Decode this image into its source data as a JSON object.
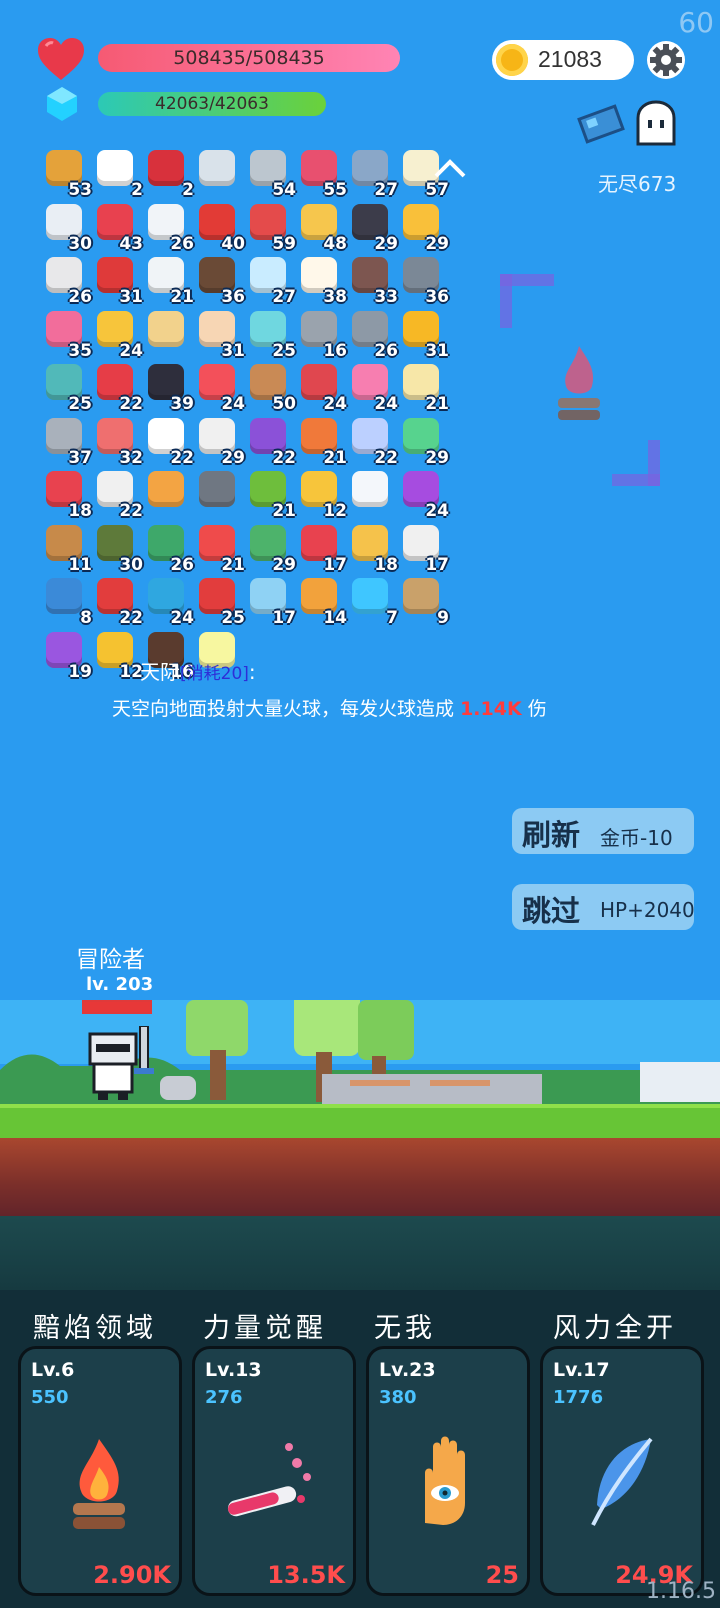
{
  "fps": "60",
  "version": "1.16.5",
  "hp": {
    "text": "508435/508435"
  },
  "mp": {
    "text": "42063/42063"
  },
  "coins": "21083",
  "endless_label": "无尽673",
  "items": [
    {
      "icon": "book-icon",
      "count": "53",
      "color": "#e4a23a"
    },
    {
      "icon": "speech-bubble-icon",
      "count": "2",
      "color": "#ffffff"
    },
    {
      "icon": "magnet-icon",
      "count": "2",
      "color": "#d8313c"
    },
    {
      "icon": "sword-icon",
      "count": "",
      "color": "#d9e2ea"
    },
    {
      "icon": "sword-icon",
      "count": "54",
      "color": "#bcc6cf"
    },
    {
      "icon": "jar-icon",
      "count": "55",
      "color": "#e8506f"
    },
    {
      "icon": "shield-icon",
      "count": "27",
      "color": "#8aa7c8"
    },
    {
      "icon": "flower-icon",
      "count": "57",
      "color": "#f7f0d0"
    },
    {
      "icon": "envelope-icon",
      "count": "30",
      "color": "#e9eef4"
    },
    {
      "icon": "watermelon-icon",
      "count": "43",
      "color": "#e8414f"
    },
    {
      "icon": "cloud-icon",
      "count": "26",
      "color": "#f1f4f8"
    },
    {
      "icon": "apple-icon",
      "count": "40",
      "color": "#e23b36"
    },
    {
      "icon": "sock-icon",
      "count": "59",
      "color": "#e44b4b"
    },
    {
      "icon": "star-card-icon",
      "count": "48",
      "color": "#f6c64d"
    },
    {
      "icon": "cauldron-icon",
      "count": "29",
      "color": "#3c3c4a"
    },
    {
      "icon": "sun-cloud-icon",
      "count": "29",
      "color": "#f9c03a"
    },
    {
      "icon": "dice-icon",
      "count": "26",
      "color": "#e8e8ea"
    },
    {
      "icon": "mushroom-icon",
      "count": "31",
      "color": "#df3a3a"
    },
    {
      "icon": "clipboard-icon",
      "count": "21",
      "color": "#f0f4f7"
    },
    {
      "icon": "coconut-icon",
      "count": "36",
      "color": "#6a4a36"
    },
    {
      "icon": "halo-icon",
      "count": "27",
      "color": "#c9ecff"
    },
    {
      "icon": "egg-icon",
      "count": "38",
      "color": "#fff8ea"
    },
    {
      "icon": "door-icon",
      "count": "33",
      "color": "#7d5650"
    },
    {
      "icon": "axe-icon",
      "count": "36",
      "color": "#7b8896"
    },
    {
      "icon": "ice-cream-icon",
      "count": "35",
      "color": "#f26d9b"
    },
    {
      "icon": "crown-icon",
      "count": "24",
      "color": "#f7c53b"
    },
    {
      "icon": "scroll-icon",
      "count": "",
      "color": "#f2d28c"
    },
    {
      "icon": "hand-icon",
      "count": "31",
      "color": "#f7d6b4"
    },
    {
      "icon": "scroll-icon",
      "count": "25",
      "color": "#6fd7e0"
    },
    {
      "icon": "meteor-icon",
      "count": "16",
      "color": "#9aa3ad"
    },
    {
      "icon": "clock-icon",
      "count": "26",
      "color": "#8d99a6"
    },
    {
      "icon": "sunflower-icon",
      "count": "31",
      "color": "#f7b825"
    },
    {
      "icon": "target-ring-icon",
      "count": "25",
      "color": "#51b9b9"
    },
    {
      "icon": "strawberry-icon",
      "count": "22",
      "color": "#e63d47"
    },
    {
      "icon": "bat-icon",
      "count": "39",
      "color": "#2e2e3c"
    },
    {
      "icon": "pill-icon",
      "count": "24",
      "color": "#f3505a"
    },
    {
      "icon": "donut-icon",
      "count": "50",
      "color": "#c98a55"
    },
    {
      "icon": "badge-icon",
      "count": "24",
      "color": "#e0474f"
    },
    {
      "icon": "potion-icon",
      "count": "24",
      "color": "#f77eb0"
    },
    {
      "icon": "note-icon",
      "count": "21",
      "color": "#f7e7a8"
    },
    {
      "icon": "spike-ball-icon",
      "count": "37",
      "color": "#a9b1bb"
    },
    {
      "icon": "meat-icon",
      "count": "32",
      "color": "#ef6f6f"
    },
    {
      "icon": "ghost-icon",
      "count": "22",
      "color": "#ffffff"
    },
    {
      "icon": "bulb-icon",
      "count": "29",
      "color": "#f0f0f0"
    },
    {
      "icon": "box-icon",
      "count": "22",
      "color": "#8b51d8"
    },
    {
      "icon": "flag-icon",
      "count": "21",
      "color": "#f0793a"
    },
    {
      "icon": "capsule-icon",
      "count": "22",
      "color": "#bcd0ff"
    },
    {
      "icon": "slime-icon",
      "count": "29",
      "color": "#57d38e"
    },
    {
      "icon": "heart-icon",
      "count": "18",
      "color": "#e8424f"
    },
    {
      "icon": "cards-icon",
      "count": "22",
      "color": "#f0f0f0"
    },
    {
      "icon": "map-scroll-icon",
      "count": "",
      "color": "#f3a443"
    },
    {
      "icon": "helmet-icon",
      "count": "",
      "color": "#6f7782"
    },
    {
      "icon": "zombie-icon",
      "count": "21",
      "color": "#6ebe3c"
    },
    {
      "icon": "wand-icon",
      "count": "12",
      "color": "#f7c53b"
    },
    {
      "icon": "wing-icon",
      "count": "",
      "color": "#f4f7fb"
    },
    {
      "icon": "crystal-ball-icon",
      "count": "24",
      "color": "#a64ce0"
    },
    {
      "icon": "bow-icon",
      "count": "11",
      "color": "#c78a4a"
    },
    {
      "icon": "grenade-icon",
      "count": "30",
      "color": "#5e7a3a"
    },
    {
      "icon": "turtle-icon",
      "count": "26",
      "color": "#3ea86a"
    },
    {
      "icon": "thermometer-icon",
      "count": "21",
      "color": "#ef4b4b"
    },
    {
      "icon": "cash-icon",
      "count": "29",
      "color": "#4db36b"
    },
    {
      "icon": "broken-heart-icon",
      "count": "17",
      "color": "#e8424f"
    },
    {
      "icon": "ring-icon",
      "count": "18",
      "color": "#f5c24b"
    },
    {
      "icon": "feather-red-icon",
      "count": "17",
      "color": "#f0f0f0"
    },
    {
      "icon": "crosshair-icon",
      "count": "8",
      "color": "#3b8ad8"
    },
    {
      "icon": "gift-icon",
      "count": "22",
      "color": "#e23d3d"
    },
    {
      "icon": "chat-icon",
      "count": "24",
      "color": "#2fa7e0"
    },
    {
      "icon": "red-card-icon",
      "count": "25",
      "color": "#e23d3d"
    },
    {
      "icon": "snow-globe-icon",
      "count": "17",
      "color": "#8fd2f4"
    },
    {
      "icon": "quest-scroll-icon",
      "count": "14",
      "color": "#f2a23c"
    },
    {
      "icon": "gem-icon",
      "count": "7",
      "color": "#3fc6ff"
    },
    {
      "icon": "noose-icon",
      "count": "9",
      "color": "#c9a16a"
    },
    {
      "icon": "purple-shield-icon",
      "count": "19",
      "color": "#9a56e0"
    },
    {
      "icon": "coins-icon",
      "count": "12",
      "color": "#f5c230"
    },
    {
      "icon": "meteor-card-icon",
      "count": "16",
      "color": "#5a3b2e"
    },
    {
      "icon": "light-card-icon",
      "count": "",
      "color": "#f7f7a0"
    }
  ],
  "skill": {
    "name_fragment": "天际",
    "cost": "[消耗20]",
    "colon": ":",
    "desc_prefix": "天空向地面投射大量火球，每发火球造成",
    "desc_value": "1.14K",
    "desc_suffix": "伤"
  },
  "refresh": {
    "label": "刷新",
    "sub": "金币-10"
  },
  "skip": {
    "label": "跳过",
    "sub": "HP+2040"
  },
  "player": {
    "name": "冒险者",
    "level": "lv. 203"
  },
  "abilities": [
    {
      "title": "黯焰领域",
      "level": "Lv.6",
      "value": "550",
      "damage": "2.90K",
      "icon": "campfire-icon"
    },
    {
      "title": "力量觉醒",
      "level": "Lv.13",
      "value": "276",
      "damage": "13.5K",
      "icon": "test-tube-icon"
    },
    {
      "title": "无我",
      "level": "Lv.23",
      "value": "380",
      "damage": "25",
      "icon": "eye-hand-icon"
    },
    {
      "title": "风力全开",
      "level": "Lv.17",
      "value": "1776",
      "damage": "24.9K",
      "icon": "feather-icon"
    }
  ]
}
